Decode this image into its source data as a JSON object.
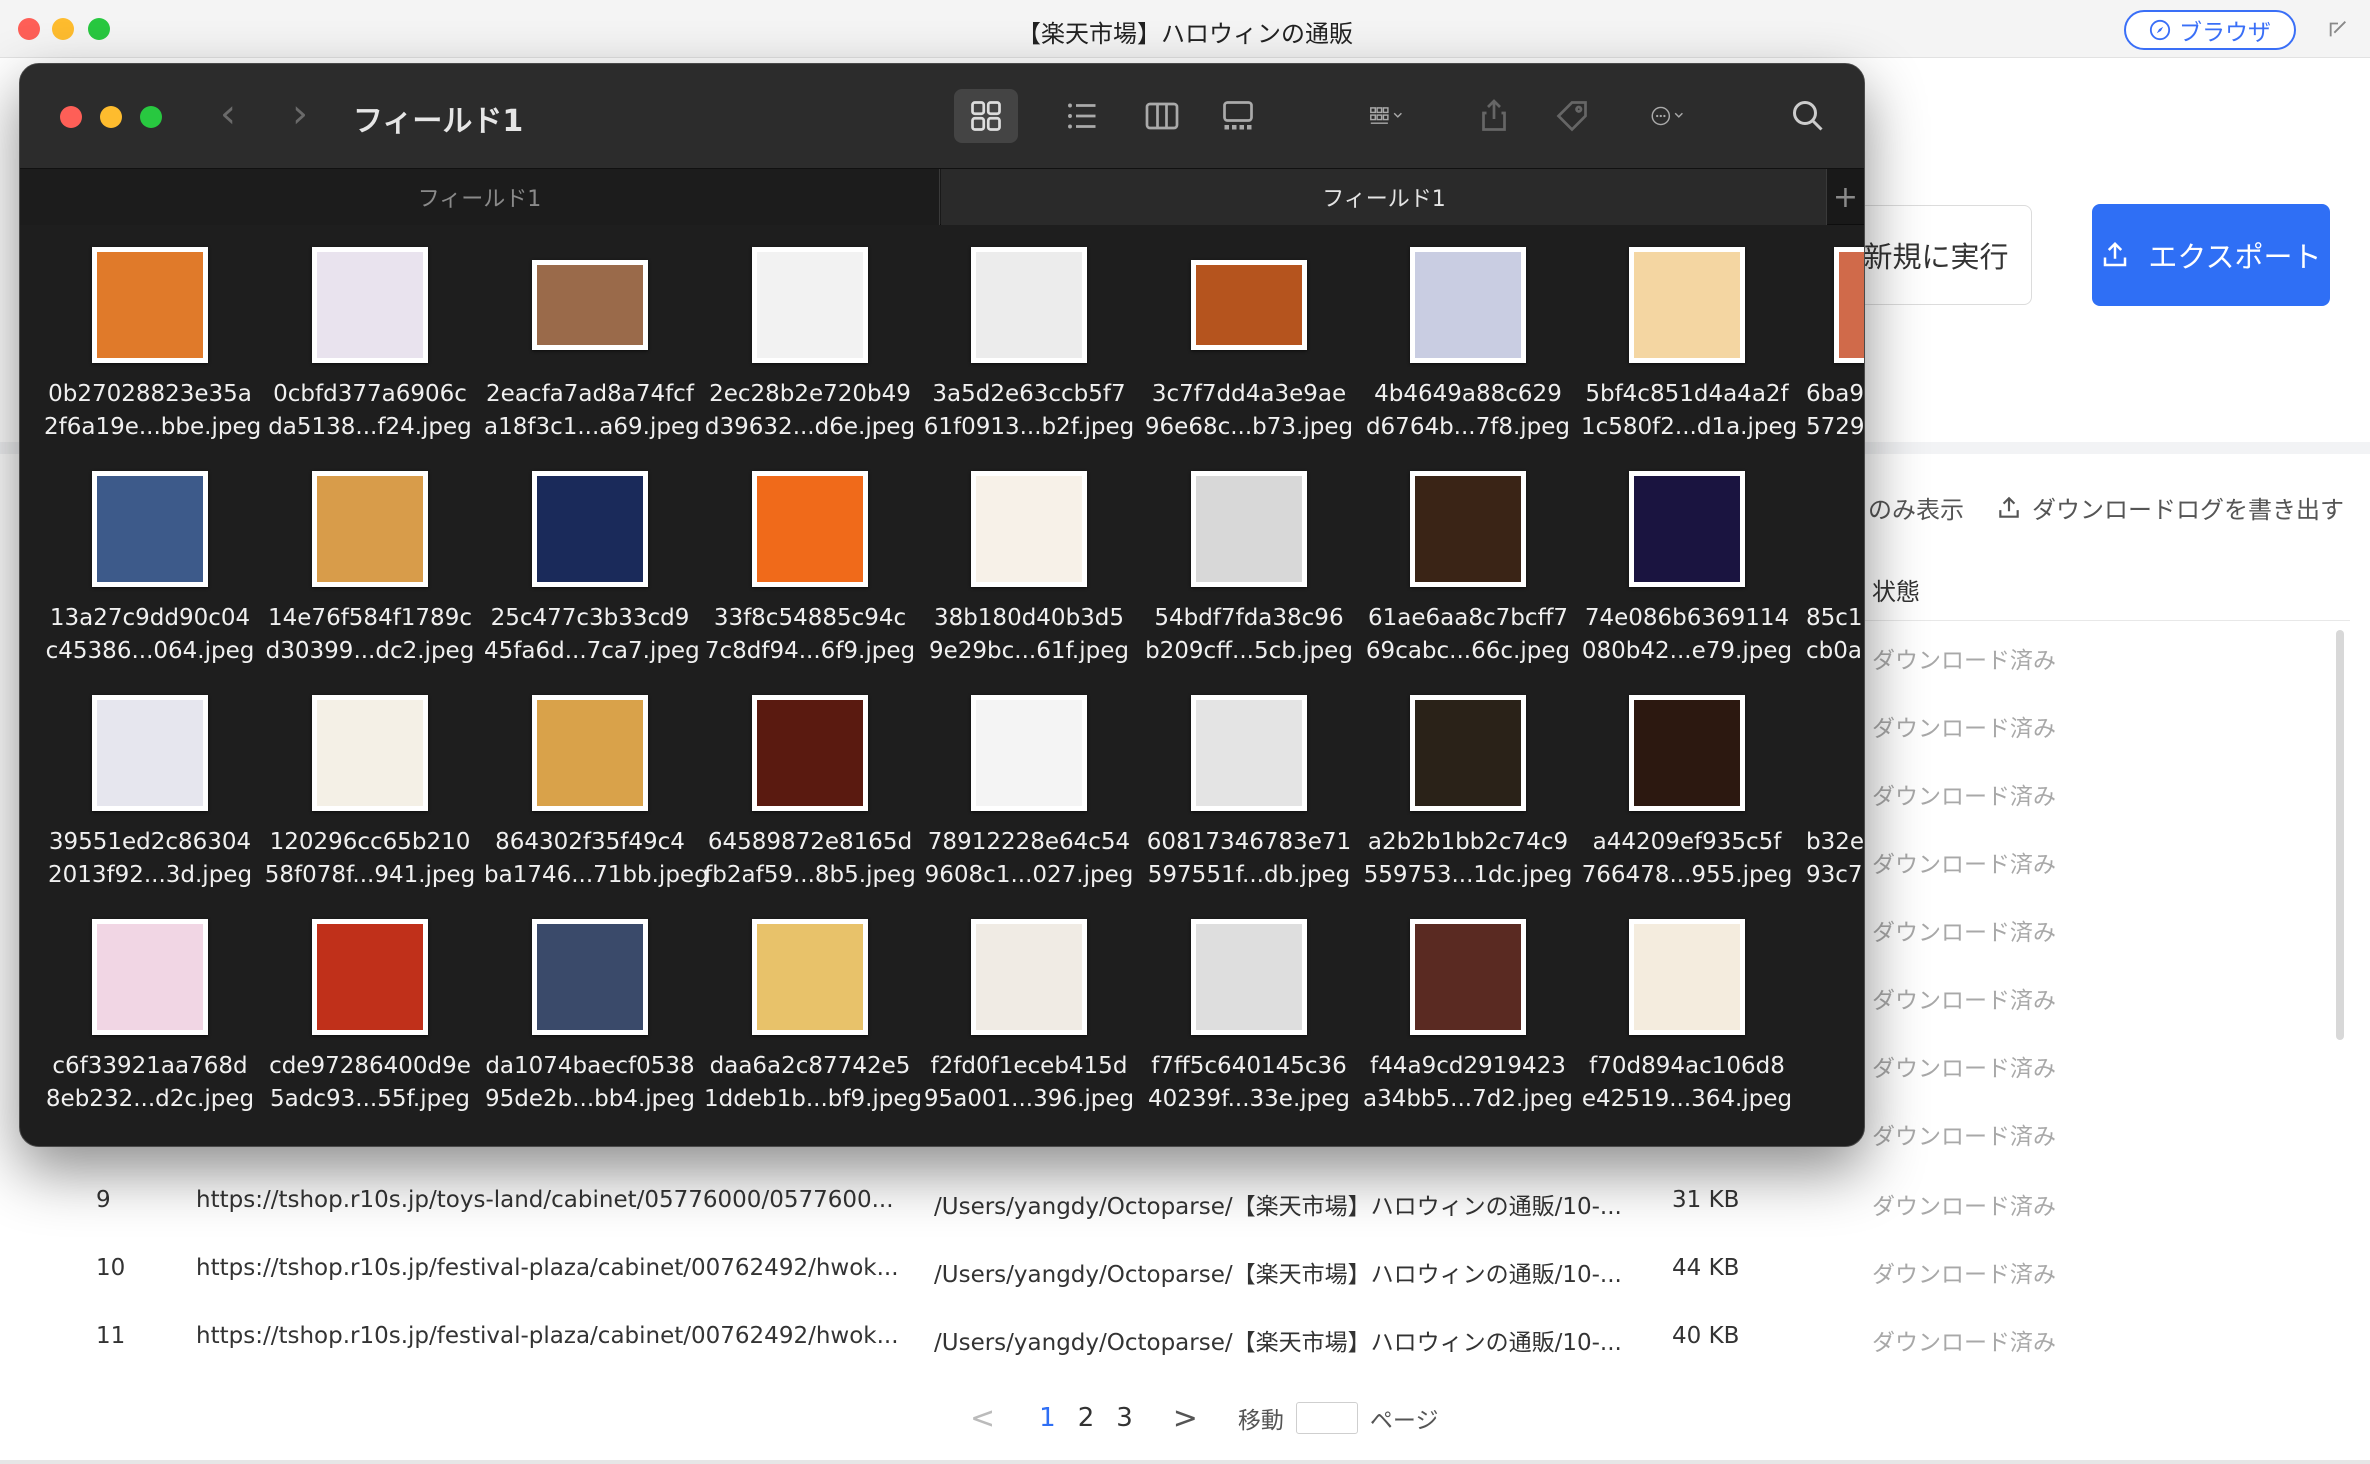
{
  "app": {
    "window_title": "【楽天市場】ハロウィンの通販",
    "browser_button": "ブラウザ",
    "rerun_button": "新規に実行",
    "export_button": "エクスポート",
    "filter_only": "のみ表示",
    "download_log_button": "ダウンロードログを書き出す",
    "status_header": "状態",
    "status_list": [
      "ダウンロード済み",
      "ダウンロード済み",
      "ダウンロード済み",
      "ダウンロード済み",
      "ダウンロード済み",
      "ダウンロード済み",
      "ダウンロード済み",
      "ダウンロード済み"
    ],
    "rows": [
      {
        "index": "9",
        "url": "https://tshop.r10s.jp/toys-land/cabinet/05776000/0577600...",
        "path": "/Users/yangdy/Octoparse/【楽天市場】ハロウィンの通販/10-...",
        "size": "31 KB",
        "status": "ダウンロード済み"
      },
      {
        "index": "10",
        "url": "https://tshop.r10s.jp/festival-plaza/cabinet/00762492/hwok...",
        "path": "/Users/yangdy/Octoparse/【楽天市場】ハロウィンの通販/10-...",
        "size": "44 KB",
        "status": "ダウンロード済み"
      },
      {
        "index": "11",
        "url": "https://tshop.r10s.jp/festival-plaza/cabinet/00762492/hwok...",
        "path": "/Users/yangdy/Octoparse/【楽天市場】ハロウィンの通販/10-...",
        "size": "40 KB",
        "status": "ダウンロード済み"
      }
    ],
    "pagination": {
      "prev": "<",
      "pages": [
        "1",
        "2",
        "3"
      ],
      "current": "1",
      "next": ">",
      "goto_label": "移動",
      "page_label": "ページ"
    }
  },
  "finder": {
    "title": "フィールド1",
    "tabs": [
      "フィールド1",
      "フィールド1"
    ],
    "tab_add": "+",
    "files": [
      {
        "line1": "0b27028823e35a",
        "line2": "2f6a19e...bbe.jpeg",
        "color": "#e07a2a"
      },
      {
        "line1": "0cbfd377a6906c",
        "line2": "da5138...f24.jpeg",
        "color": "#e9e3ee"
      },
      {
        "line1": "2eacfa7ad8a74fcf",
        "line2": "a18f3c1...a69.jpeg",
        "color": "#9a6a4a"
      },
      {
        "line1": "2ec28b2e720b49",
        "line2": "d39632...d6e.jpeg",
        "color": "#f2f2f2"
      },
      {
        "line1": "3a5d2e63ccb5f7",
        "line2": "61f0913...b2f.jpeg",
        "color": "#ececec"
      },
      {
        "line1": "3c7f7dd4a3e9ae",
        "line2": "96e68c...b73.jpeg",
        "color": "#b5541e"
      },
      {
        "line1": "4b4649a88c629",
        "line2": "d6764b...7f8.jpeg",
        "color": "#c9cde2"
      },
      {
        "line1": "5bf4c851d4a4a2f",
        "line2": "1c580f2...d1a.jpeg",
        "color": "#f4d6a2"
      },
      {
        "line1": "13a27c9dd90c04",
        "line2": "c45386...064.jpeg",
        "color": "#3d5a8a"
      },
      {
        "line1": "14e76f584f1789c",
        "line2": "d30399...dc2.jpeg",
        "color": "#d89c4a"
      },
      {
        "line1": "25c477c3b33cd9",
        "line2": "45fa6d...7ca7.jpeg",
        "color": "#1a2a5a"
      },
      {
        "line1": "33f8c54885c94c",
        "line2": "7c8df94...6f9.jpeg",
        "color": "#f06a1a"
      },
      {
        "line1": "38b180d40b3d5",
        "line2": "9e29bc...61f.jpeg",
        "color": "#f7f1e8"
      },
      {
        "line1": "54bdf7fda38c96",
        "line2": "b209cff...5cb.jpeg",
        "color": "#d8d8d8"
      },
      {
        "line1": "61ae6aa8c7bcff7",
        "line2": "69cabc...66c.jpeg",
        "color": "#3a2416"
      },
      {
        "line1": "74e086b6369114",
        "line2": "080b42...e79.jpeg",
        "color": "#1a1440"
      },
      {
        "line1": "39551ed2c86304",
        "line2": "2013f92...3d.jpeg",
        "color": "#e6e6ee"
      },
      {
        "line1": "120296cc65b210",
        "line2": "58f078f...941.jpeg",
        "color": "#f4f0e6"
      },
      {
        "line1": "864302f35f49c4",
        "line2": "ba1746...71bb.jpeg",
        "color": "#d9a24a"
      },
      {
        "line1": "64589872e8165d",
        "line2": "fb2af59...8b5.jpeg",
        "color": "#5a1a10"
      },
      {
        "line1": "78912228e64c54",
        "line2": "9608c1...027.jpeg",
        "color": "#f4f4f4"
      },
      {
        "line1": "60817346783e71",
        "line2": "597551f...db.jpeg",
        "color": "#e4e4e4"
      },
      {
        "line1": "a2b2b1bb2c74c9",
        "line2": "559753...1dc.jpeg",
        "color": "#2a2218"
      },
      {
        "line1": "a44209ef935c5f",
        "line2": "766478...955.jpeg",
        "color": "#2c1810"
      },
      {
        "line1": "c6f33921aa768d",
        "line2": "8eb232...d2c.jpeg",
        "color": "#f1d6e4"
      },
      {
        "line1": "cde97286400d9e",
        "line2": "5adc93...55f.jpeg",
        "color": "#c0301a"
      },
      {
        "line1": "da1074baecf0538",
        "line2": "95de2b...bb4.jpeg",
        "color": "#3a4a6a"
      },
      {
        "line1": "daa6a2c87742e5",
        "line2": "1ddeb1b...bf9.jpeg",
        "color": "#e8c26a"
      },
      {
        "line1": "f2fd0f1eceb415d",
        "line2": "95a001...396.jpeg",
        "color": "#f0ebe4"
      },
      {
        "line1": "f7ff5c640145c36",
        "line2": "40239f...33e.jpeg",
        "color": "#dedede"
      },
      {
        "line1": "f44a9cd2919423",
        "line2": "a34bb5...7d2.jpeg",
        "color": "#5a2a22"
      },
      {
        "line1": "f70d894ac106d8",
        "line2": "e42519...364.jpeg",
        "color": "#f4ecde"
      }
    ],
    "partial_files": [
      {
        "line1": "6ba9",
        "line2": "5729",
        "color": "#d06a4a"
      },
      {
        "line1": "85c1",
        "line2": "cb0a",
        "color": "#1e1e1e"
      },
      {
        "line1": "b32e",
        "line2": "93c7",
        "color": "#1e1e1e"
      }
    ]
  }
}
